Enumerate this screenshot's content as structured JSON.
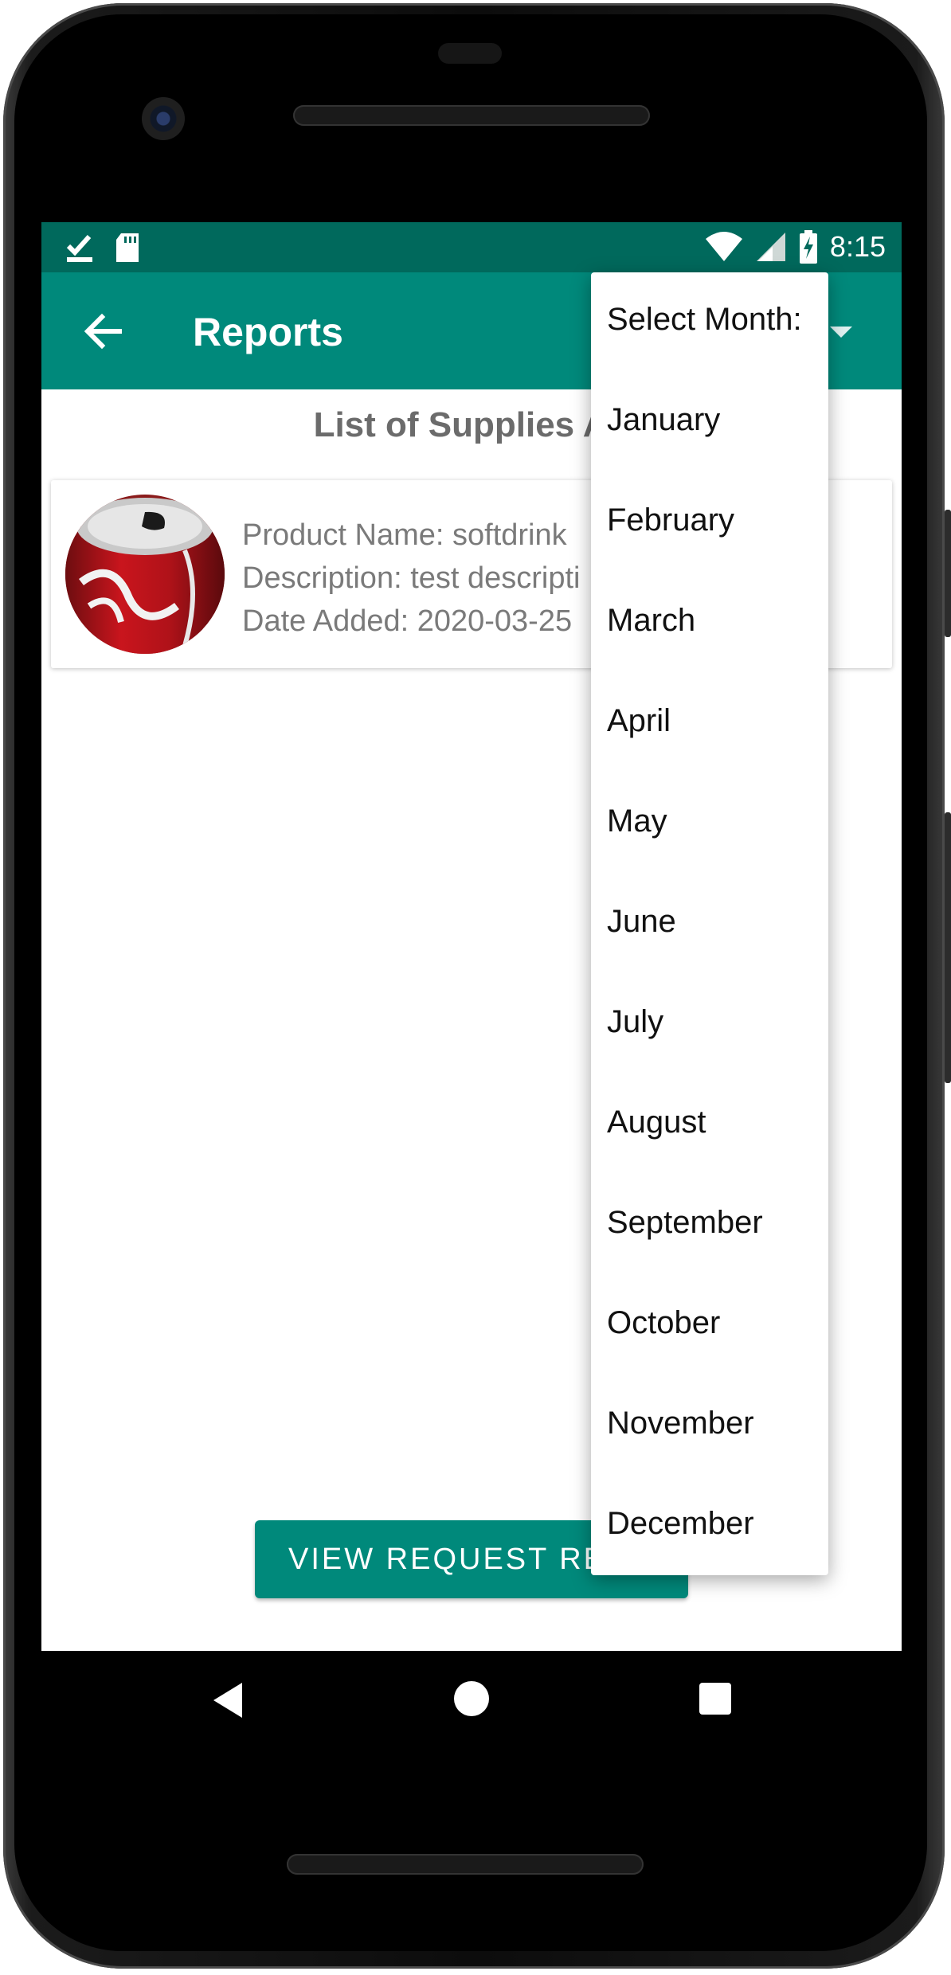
{
  "status_bar": {
    "time": "8:15",
    "left_icons": [
      "check-download-icon",
      "sd-card-icon"
    ],
    "right_icons": [
      "wifi-icon",
      "signal-icon",
      "battery-charging-icon"
    ]
  },
  "app_bar": {
    "title": "Reports",
    "back_icon": "arrow-left-icon",
    "background": "#00897b",
    "status_background": "#00695c"
  },
  "main": {
    "heading": "List of Supplies Ad",
    "items": [
      {
        "product_name": "Product Name: softdrink",
        "description": "Description: test descripti",
        "date_added": "Date Added: 2020-03-25",
        "image_icon": "soda-can-image"
      }
    ],
    "view_button_label": "VIEW REQUEST REP"
  },
  "dropdown": {
    "header": "Select Month:",
    "options": [
      "January",
      "February",
      "March",
      "April",
      "May",
      "June",
      "July",
      "August",
      "September",
      "October",
      "November",
      "December"
    ]
  },
  "nav": {
    "back_icon": "nav-back-icon",
    "home_icon": "nav-home-icon",
    "recent_icon": "nav-recent-icon"
  }
}
